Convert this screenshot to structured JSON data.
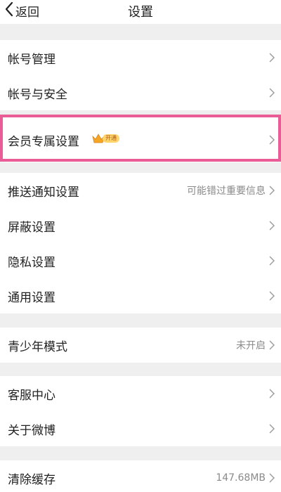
{
  "header": {
    "back_label": "返回",
    "title": "设置"
  },
  "groups": [
    {
      "rows": [
        {
          "label": "帐号管理"
        },
        {
          "label": "帐号与安全"
        }
      ]
    },
    {
      "rows": [
        {
          "label": "会员专属设置",
          "badge": "开通"
        }
      ]
    },
    {
      "rows": [
        {
          "label": "推送通知设置",
          "value": "可能错过重要信息"
        },
        {
          "label": "屏蔽设置"
        },
        {
          "label": "隐私设置"
        },
        {
          "label": "通用设置"
        }
      ]
    },
    {
      "rows": [
        {
          "label": "青少年模式",
          "value": "未开启"
        }
      ]
    },
    {
      "rows": [
        {
          "label": "客服中心"
        },
        {
          "label": "关于微博"
        }
      ]
    },
    {
      "rows": [
        {
          "label": "清除缓存",
          "value": "147.68MB"
        }
      ]
    }
  ],
  "colors": {
    "highlight_border": "#ea5c95",
    "badge_bg": "#ffd46b",
    "crown": "#f5a623"
  },
  "icons": {
    "back": "chevron-left-icon",
    "row_arrow": "chevron-right-icon",
    "vip": "crown-icon"
  }
}
